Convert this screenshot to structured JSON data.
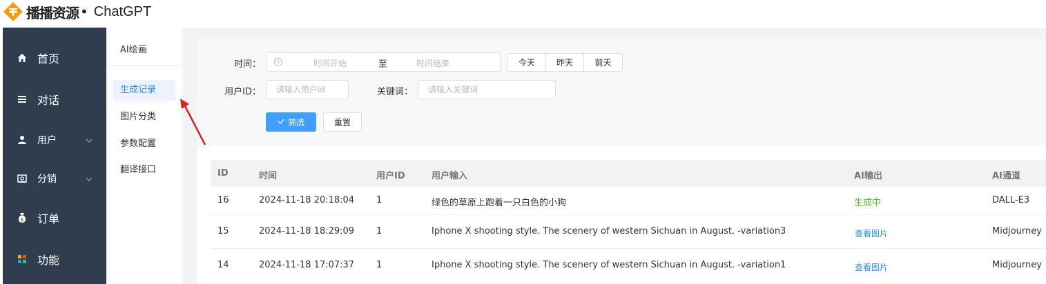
{
  "header": {
    "brand": "播播资源",
    "dot": "•",
    "app_name": "ChatGPT"
  },
  "sidebar": {
    "items": [
      {
        "label": "首页",
        "icon": "home-icon"
      },
      {
        "label": "对话",
        "icon": "menu-icon"
      },
      {
        "label": "用户",
        "icon": "user-icon",
        "expandable": true
      },
      {
        "label": "分销",
        "icon": "share-icon",
        "expandable": true
      },
      {
        "label": "订单",
        "icon": "money-bag-icon"
      },
      {
        "label": "功能",
        "icon": "grid-icon"
      }
    ]
  },
  "submenu": {
    "title": "AI绘画",
    "items": [
      {
        "label": "生成记录",
        "active": true
      },
      {
        "label": "图片分类"
      },
      {
        "label": "参数配置"
      },
      {
        "label": "翻译接口"
      }
    ]
  },
  "filters": {
    "time_label": "时间：",
    "start_placeholder": "时间开始",
    "range_sep": "至",
    "end_placeholder": "时间结束",
    "quick": [
      "今天",
      "昨天",
      "前天"
    ],
    "user_id_label": "用户ID：",
    "user_id_placeholder": "请输入用户id",
    "keyword_label": "关键词：",
    "keyword_placeholder": "请输入关键词",
    "filter_button": "筛选",
    "reset_button": "重置"
  },
  "table": {
    "columns": [
      "ID",
      "时间",
      "用户ID",
      "用户输入",
      "AI输出",
      "AI通道"
    ],
    "rows": [
      {
        "id": "16",
        "time": "2024-11-18 20:18:04",
        "user_id": "1",
        "input": "绿色的草原上跑着一只白色的小狗",
        "output": "生成中",
        "output_type": "status",
        "channel": "DALL-E3"
      },
      {
        "id": "15",
        "time": "2024-11-18 18:29:09",
        "user_id": "1",
        "input": "Iphone X shooting style. The scenery of western Sichuan in August.  -variation3",
        "output": "查看图片",
        "output_type": "link",
        "channel": "Midjourney"
      },
      {
        "id": "14",
        "time": "2024-11-18 17:07:37",
        "user_id": "1",
        "input": "Iphone X shooting style. The scenery of western Sichuan in August. -variation1",
        "output": "查看图片",
        "output_type": "link",
        "channel": "Midjourney"
      }
    ]
  },
  "colors": {
    "sidebar_bg": "#2f3d4f",
    "primary": "#409eff",
    "link": "#2d8cf0",
    "status_green": "#52c41a",
    "arrow": "#e02020",
    "logo_orange": "#f39c12"
  }
}
